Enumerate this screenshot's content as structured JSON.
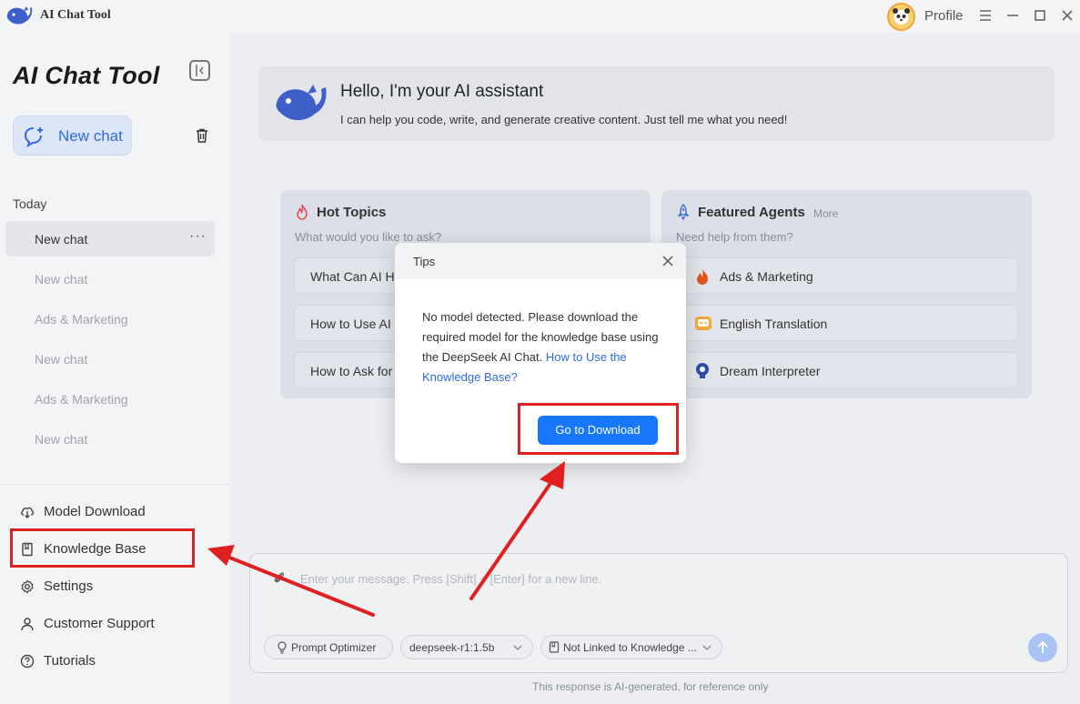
{
  "titlebar": {
    "app_name": "AI Chat Tool",
    "profile_label": "Profile"
  },
  "sidebar": {
    "brand": "AI Chat Tool",
    "new_chat_label": "New chat",
    "section_today": "Today",
    "history": [
      {
        "label": "New chat",
        "active": true
      },
      {
        "label": "New chat"
      },
      {
        "label": "Ads & Marketing"
      },
      {
        "label": "New chat"
      },
      {
        "label": "Ads & Marketing"
      },
      {
        "label": "New chat"
      }
    ],
    "more_dots": "···",
    "nav": [
      {
        "label": "Model Download",
        "icon": "cloud-download-icon"
      },
      {
        "label": "Knowledge Base",
        "icon": "book-icon"
      },
      {
        "label": "Settings",
        "icon": "gear-icon"
      },
      {
        "label": "Customer Support",
        "icon": "user-icon"
      },
      {
        "label": "Tutorials",
        "icon": "question-circle-icon"
      }
    ]
  },
  "welcome": {
    "title": "Hello, I'm your AI assistant",
    "subtitle": "I can help you code, write, and generate creative content. Just tell me what you need!"
  },
  "hot_topics": {
    "title": "Hot Topics",
    "subtitle": "What would you like to ask?",
    "items": [
      "What Can AI He",
      "How to Use AI",
      "How to Ask for"
    ]
  },
  "featured_agents": {
    "title": "Featured Agents",
    "more_label": "More",
    "subtitle": "Need help from them?",
    "items": [
      {
        "label": "Ads & Marketing",
        "icon": "flame-icon"
      },
      {
        "label": "English Translation",
        "icon": "translate-icon"
      },
      {
        "label": "Dream Interpreter",
        "icon": "dream-icon"
      }
    ]
  },
  "composer": {
    "placeholder": "Enter your message. Press [Shift] + [Enter] for a new line.",
    "prompt_optimizer_label": "Prompt Optimizer",
    "model_select_value": "deepseek-r1:1.5b",
    "knowledge_select_value": "Not Linked to Knowledge ...",
    "disclaimer": "This response is AI-generated, for reference only"
  },
  "modal": {
    "title": "Tips",
    "message": "No model detected. Please download the required model for the knowledge base using the DeepSeek AI Chat. ",
    "link_text": "How to Use the Knowledge Base?",
    "primary_label": "Go to Download"
  },
  "colors": {
    "accent": "#1677ff",
    "link": "#2f6be6",
    "annotation": "#e02020"
  }
}
